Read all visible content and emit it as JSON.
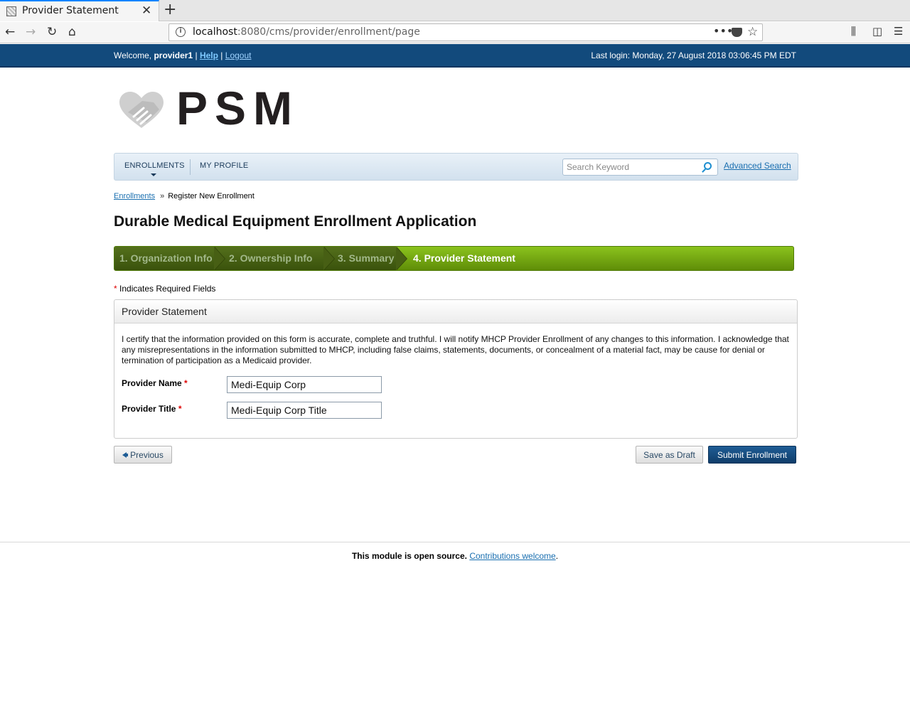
{
  "browser": {
    "tab_title": "Provider Statement",
    "url_host": "localhost",
    "url_rest": ":8080/cms/provider/enrollment/page"
  },
  "topbar": {
    "welcome_prefix": "Welcome, ",
    "username": "provider1",
    "separator1": " | ",
    "help": "Help",
    "separator2": " | ",
    "logout": "Logout",
    "last_login": "Last login: Monday, 27 August 2018 03:06:45 PM EDT"
  },
  "logo": {
    "text": "PSM"
  },
  "nav": {
    "enrollments": "ENROLLMENTS",
    "my_profile": "MY PROFILE",
    "search_placeholder": "Search Keyword",
    "advanced_search": "Advanced Search"
  },
  "breadcrumb": {
    "root": "Enrollments",
    "current": "Register New Enrollment"
  },
  "page_title": "Durable Medical Equipment Enrollment Application",
  "steps": [
    {
      "label": "1. Organization Info",
      "state": "done"
    },
    {
      "label": "2. Ownership Info",
      "state": "done"
    },
    {
      "label": "3. Summary",
      "state": "done"
    },
    {
      "label": "4. Provider Statement",
      "state": "current"
    }
  ],
  "required_note": {
    "star": "*",
    "text": " Indicates Required Fields"
  },
  "panel": {
    "title": "Provider Statement",
    "certification": "I certify that the information provided on this form is accurate, complete and truthful. I will notify MHCP Provider Enrollment of any changes to this information. I acknowledge that any misrepresentations in the information submitted to MHCP, including false claims, statements, documents, or concealment of a material fact, may be cause for denial or termination of participation as a Medicaid provider.",
    "fields": {
      "provider_name_label": "Provider Name",
      "provider_name_value": "Medi-Equip Corp",
      "provider_title_label": "Provider Title",
      "provider_title_value": "Medi-Equip Corp Title",
      "required_star": "*"
    }
  },
  "buttons": {
    "previous": "Previous",
    "save_draft": "Save as Draft",
    "submit": "Submit Enrollment"
  },
  "footer": {
    "bold": "This module is open source.",
    "link": "Contributions welcome",
    "period": "."
  },
  "colors": {
    "header_blue": "#124a7c",
    "step_green": "#7ab317",
    "primary_button": "#164c80",
    "link_blue": "#1a6fb0",
    "required_red": "#dd0000"
  }
}
